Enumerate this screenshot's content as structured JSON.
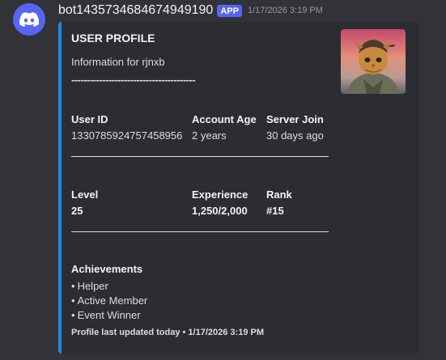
{
  "message": {
    "username": "bot1435734684674949190",
    "badge": "APP",
    "timestamp": "1/17/2026 3:19 PM",
    "avatar_icon": "discord-logo-icon"
  },
  "embed": {
    "accent_color": "#1e88e5",
    "title": "USER PROFILE",
    "description": "Information for rjnxb",
    "separator": "----------------------------------------",
    "thumbnail_icon": "cat-pilot-thumbnail",
    "fields_row1": [
      {
        "name": "User ID",
        "value": "1330785924757458956"
      },
      {
        "name": "Account Age",
        "value": "2 years"
      },
      {
        "name": "Server Join",
        "value": "30 days ago"
      }
    ],
    "fields_row2": [
      {
        "name": "Level",
        "value": "25"
      },
      {
        "name": "Experience",
        "value": "1,250/2,000"
      },
      {
        "name": "Rank",
        "value": "#15"
      }
    ],
    "achievements": {
      "title": "Achievements",
      "bullet": "•",
      "items": [
        "Helper",
        "Active Member",
        "Event Winner"
      ]
    },
    "footer": "Profile last updated today • 1/17/2026 3:19 PM"
  }
}
